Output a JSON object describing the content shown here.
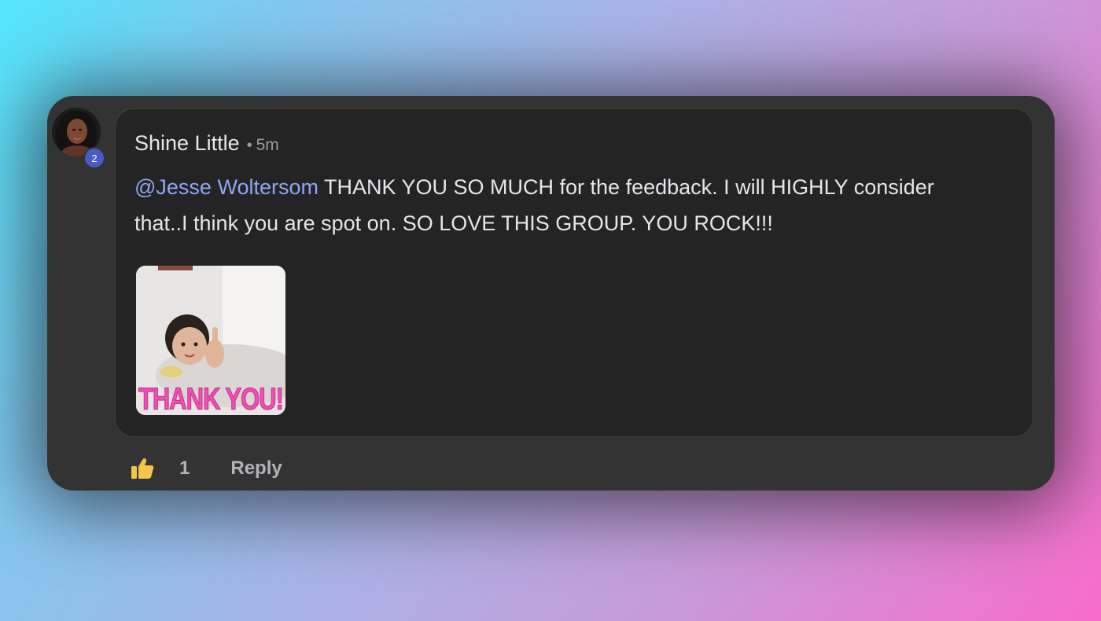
{
  "comment": {
    "author": "Shine Little",
    "time": "5m",
    "mention": "@Jesse Woltersom",
    "text": " THANK YOU SO MUCH for the feedback. I will HIGHLY consider that..I think you are spot on. SO LOVE THIS GROUP. YOU ROCK!!!",
    "avatar_badge": "2",
    "attachment": {
      "caption": "THANK YOU!"
    }
  },
  "actions": {
    "like_count": "1",
    "reply_label": "Reply"
  },
  "colors": {
    "mention": "#8fa6f1",
    "badge": "#4b5bc5",
    "like_icon": "#f2c64b",
    "gif_caption": "#f04fb4"
  },
  "icons": {
    "like": "thumbs-up-icon"
  }
}
